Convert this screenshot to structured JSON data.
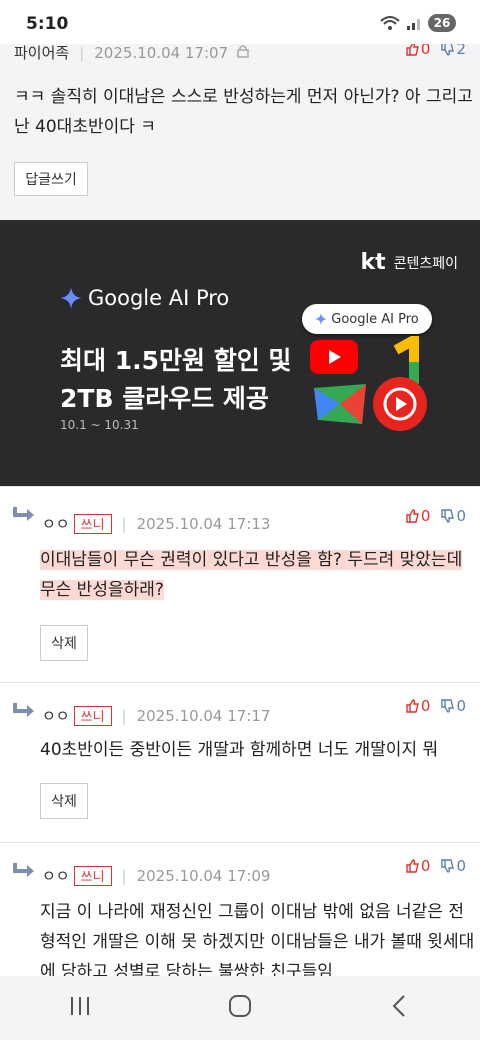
{
  "status": {
    "time": "5:10",
    "battery": "26"
  },
  "top_comment": {
    "nick": "파이어족",
    "date": "2025.10.04 17:07",
    "up": "0",
    "down": "2",
    "text_line1": "ㅋㅋ 솔직히 이대남은 스스로 반성하는게 먼저 아닌가? 아 그리고",
    "text_line2": "난 40대초반이다 ㅋ",
    "reply_button": "답글쓰기"
  },
  "ad": {
    "brand": "kt",
    "service": "콘텐츠페이",
    "product": "Google AI Pro",
    "headline1": "최대 1.5만원 할인 및",
    "headline2": "2TB 클라우드 제공",
    "period": "10.1 ~ 10.31",
    "pill": "Google AI Pro"
  },
  "replies": [
    {
      "nick": "ㅇㅇ",
      "badge": "쓰니",
      "date": "2025.10.04 17:13",
      "up": "0",
      "down": "0",
      "line1": "이대남들이 무슨 권력이 있다고 반성을 함? 두드려 맞았는데",
      "line2": "무슨 반성을하래?",
      "delete": "삭제"
    },
    {
      "nick": "ㅇㅇ",
      "badge": "쓰니",
      "date": "2025.10.04 17:17",
      "up": "0",
      "down": "0",
      "line1": "40초반이든 중반이든 개딸과 함께하면 너도 개딸이지 뭐",
      "delete": "삭제"
    },
    {
      "nick": "ㅇㅇ",
      "badge": "쓰니",
      "date": "2025.10.04 17:09",
      "up": "0",
      "down": "0",
      "line1": "지금 이 나라에 재정신인 그룹이 이대남 밖에 없음 너같은 전",
      "line2": "형적인 개딸은 이해 못 하겠지만 이대남들은 내가 볼때 윗세대",
      "line3": "에 당하고 성별로 당하는 불쌍한 친구들임"
    }
  ]
}
